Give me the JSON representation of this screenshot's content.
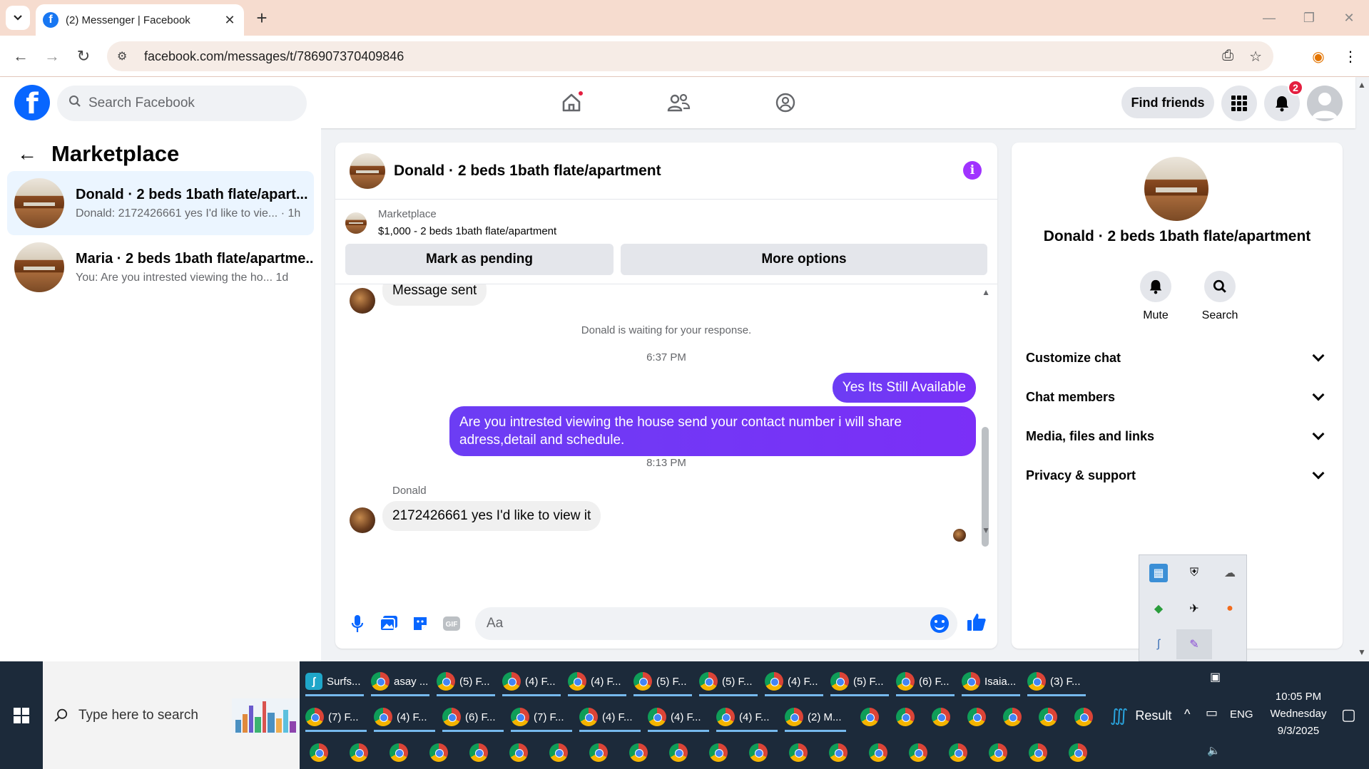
{
  "browser": {
    "tab_title": "(2) Messenger | Facebook",
    "tab_favicon": "f",
    "url": "facebook.com/messages/t/786907370409846"
  },
  "fb": {
    "search_placeholder": "Search Facebook",
    "find_friends_label": "Find friends",
    "notification_count": "2",
    "logo_letter": "f"
  },
  "marketplace": {
    "title": "Marketplace",
    "conversations": [
      {
        "name": "Donald · 2 beds 1bath flate/apart...",
        "preview": "Donald: 2172426661 yes I'd like to vie... · 1h"
      },
      {
        "name": "Maria · 2 beds 1bath flate/apartme...",
        "preview": "You: Are you intrested viewing the ho...   1d"
      }
    ]
  },
  "chat": {
    "title": "Donald · 2 beds 1bath flate/apartment",
    "listing_label": "Marketplace",
    "listing_price": "$1,000 - 2 beds 1bath flate/apartment",
    "mark_pending_label": "Mark as pending",
    "more_options_label": "More options",
    "messages": {
      "sent_notice": "Message sent",
      "waiting_notice": "Donald is waiting for your response.",
      "time1": "6:37 PM",
      "out1": "Yes Its Still Available",
      "out2": "Are you intrested viewing the house send your contact number i will share adress,detail and schedule.",
      "time2": "8:13 PM",
      "sender": "Donald",
      "in1": "2172426661 yes I'd like to view it"
    },
    "composer_placeholder": "Aa"
  },
  "right_panel": {
    "name": "Donald · 2 beds 1bath flate/apartment",
    "mute_label": "Mute",
    "search_label": "Search",
    "rows": [
      "Customize chat",
      "Chat members",
      "Media, files and links",
      "Privacy & support"
    ]
  },
  "taskbar": {
    "search_placeholder": "Type here to search",
    "row1": [
      "Surfs...",
      "asay ...",
      "(5) F...",
      "(4) F...",
      "(4) F...",
      "(5) F...",
      "(5) F...",
      "(4) F...",
      "(5) F...",
      "(6) F...",
      "Isaia...",
      "(3) F..."
    ],
    "row2": [
      "(7) F...",
      "(4) F...",
      "(6) F...",
      "(7) F...",
      "(4) F...",
      "(4) F...",
      "(4) F...",
      "(2) M..."
    ],
    "weather": "Result",
    "lang": "ENG",
    "time": "10:05 PM",
    "day": "Wednesday",
    "date": "9/3/2025"
  },
  "colors": {
    "fb_blue": "#0866ff",
    "bubble_purple": "#7b2ff7",
    "chrome_tab_bg": "#f6dccf",
    "taskbar_bg": "#1c2a3a"
  }
}
